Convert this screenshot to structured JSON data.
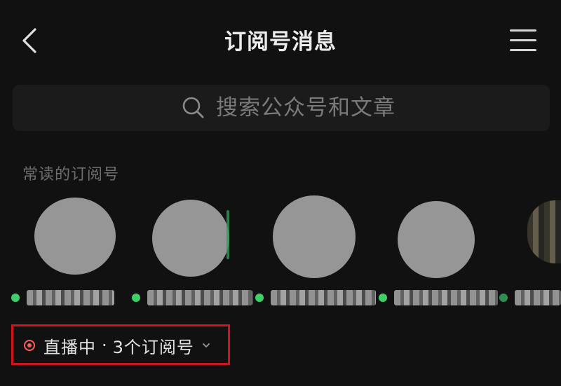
{
  "header": {
    "title": "订阅号消息",
    "back_icon": "chevron-left-icon",
    "menu_icon": "hamburger-menu-icon"
  },
  "search": {
    "placeholder": "搜索公众号和文章",
    "icon": "search-icon"
  },
  "frequent": {
    "title": "常读的订阅号",
    "accounts_visible": 5
  },
  "live": {
    "status_label": "直播中",
    "separator": "·",
    "count_label": "3个订阅号",
    "indicator_color": "#ff5b5b",
    "expand_icon": "chevron-down-icon"
  },
  "colors": {
    "background": "#111111",
    "online_dot": "#3ecf6a",
    "highlight_box": "#d0141f"
  }
}
